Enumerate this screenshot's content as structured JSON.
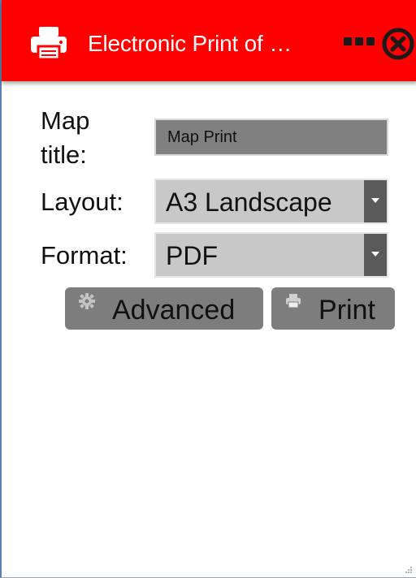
{
  "header": {
    "title": "Electronic Print of …",
    "background_color": "#ff0000",
    "icons": {
      "leading": "printer-icon",
      "more": "more-options-icon",
      "close": "close-icon"
    }
  },
  "form": {
    "map_title": {
      "label": "Map title:",
      "value": "Map Print"
    },
    "layout": {
      "label": "Layout:",
      "selected": "A3 Landscape"
    },
    "format": {
      "label": "Format:",
      "selected": "PDF"
    }
  },
  "buttons": {
    "advanced": {
      "label": "Advanced",
      "icon": "gear-icon"
    },
    "print": {
      "label": "Print",
      "icon": "printer-icon"
    }
  }
}
